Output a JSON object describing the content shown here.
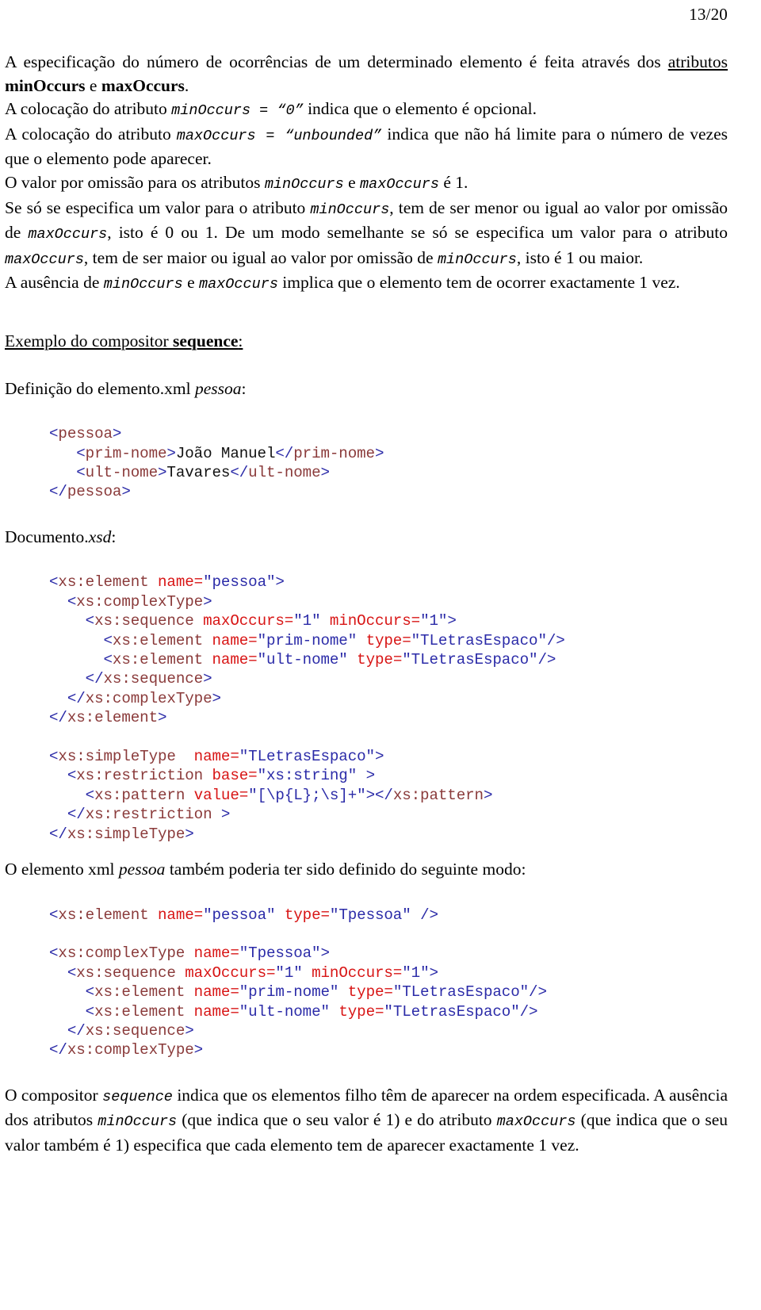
{
  "document": {
    "page_number": "13/20",
    "language": "pt-PT"
  },
  "colors": {
    "bracket": "#2b2ba8",
    "tag_name": "#8a3a3a",
    "attribute_name": "#d81515",
    "attribute_value": "#2b2ba8",
    "text": "#111111"
  },
  "paragraphs": {
    "p1_a": "A especificação do número de ocorrências de um determinado elemento é feita através dos ",
    "p1_underline": "atributos",
    "p1_b": " ",
    "p1_bold1": "minOccurs",
    "p1_c": " e ",
    "p1_bold2": "maxOccurs",
    "p1_d": ".",
    "p2_a": "A colocação do atributo ",
    "p2_code1": "minOccurs = “0”",
    "p2_b": " indica que o elemento é opcional.",
    "p3_a": "A colocação do atributo ",
    "p3_code1": "maxOccurs = “unbounded”",
    "p3_b": " indica que não há limite para o número de vezes que o elemento pode aparecer.",
    "p4_a": "O valor por omissão para os atributos ",
    "p4_code1": "minOccurs",
    "p4_b": " e ",
    "p4_code2": "maxOccurs",
    "p4_c": " é 1.",
    "p5_a": "Se só se especifica um valor para o atributo ",
    "p5_code1": "minOccurs",
    "p5_b": ", tem de ser menor ou igual ao valor por omissão de ",
    "p5_code2": "maxOccurs",
    "p5_c": ", isto é 0 ou 1. De um modo semelhante se só se especifica um valor para o atributo ",
    "p5_code3": "maxOccurs",
    "p5_d": ", tem de ser maior ou igual ao valor por omissão de ",
    "p5_code4": "minOccurs",
    "p5_e": ", isto é 1 ou maior.",
    "p6_a": "A ausência de ",
    "p6_code1": "minOccurs",
    "p6_b": " e ",
    "p6_code2": "maxOccurs",
    "p6_c": " implica que o elemento tem de ocorrer exactamente 1 vez.",
    "heading1_a": "Exemplo do compositor ",
    "heading1_bold": "sequence",
    "heading1_b": ":",
    "caption1_a": "Definição do elemento.xml ",
    "caption1_italic": "pessoa",
    "caption1_b": ":",
    "caption2_a": "Documento.",
    "caption2_italic": "xsd",
    "caption2_b": ":",
    "caption3_a": "O elemento xml ",
    "caption3_italic": "pessoa",
    "caption3_b": " também poderia ter sido definido do seguinte modo:",
    "p7_a": "O compositor ",
    "p7_code1": "sequence",
    "p7_b": " indica que os elementos filho têm de aparecer na ordem especificada. A ausência dos atributos ",
    "p7_code2": "minOccurs",
    "p7_c": " (que indica que o seu valor é 1) e do atributo ",
    "p7_code3": "maxOccurs",
    "p7_d": " (que indica que o seu valor também é 1) especifica que cada elemento tem de aparecer exactamente 1 vez."
  },
  "code_blocks": {
    "xml_pessoa": [
      [
        {
          "t": "br",
          "v": "<"
        },
        {
          "t": "tag",
          "v": "pessoa"
        },
        {
          "t": "br",
          "v": ">"
        }
      ],
      [
        {
          "t": "txt",
          "v": "   "
        },
        {
          "t": "br",
          "v": "<"
        },
        {
          "t": "tag",
          "v": "prim-nome"
        },
        {
          "t": "br",
          "v": ">"
        },
        {
          "t": "txt",
          "v": "João Manuel"
        },
        {
          "t": "br",
          "v": "</"
        },
        {
          "t": "tag",
          "v": "prim-nome"
        },
        {
          "t": "br",
          "v": ">"
        }
      ],
      [
        {
          "t": "txt",
          "v": "   "
        },
        {
          "t": "br",
          "v": "<"
        },
        {
          "t": "tag",
          "v": "ult-nome"
        },
        {
          "t": "br",
          "v": ">"
        },
        {
          "t": "txt",
          "v": "Tavares"
        },
        {
          "t": "br",
          "v": "</"
        },
        {
          "t": "tag",
          "v": "ult-nome"
        },
        {
          "t": "br",
          "v": ">"
        }
      ],
      [
        {
          "t": "br",
          "v": "</"
        },
        {
          "t": "tag",
          "v": "pessoa"
        },
        {
          "t": "br",
          "v": ">"
        }
      ]
    ],
    "xsd_documento": [
      [
        {
          "t": "br",
          "v": "<"
        },
        {
          "t": "tag",
          "v": "xs:element"
        },
        {
          "t": "txt",
          "v": " "
        },
        {
          "t": "attr",
          "v": "name="
        },
        {
          "t": "val",
          "v": "\"pessoa\""
        },
        {
          "t": "br",
          "v": ">"
        }
      ],
      [
        {
          "t": "txt",
          "v": "  "
        },
        {
          "t": "br",
          "v": "<"
        },
        {
          "t": "tag",
          "v": "xs:complexType"
        },
        {
          "t": "br",
          "v": ">"
        }
      ],
      [
        {
          "t": "txt",
          "v": "    "
        },
        {
          "t": "br",
          "v": "<"
        },
        {
          "t": "tag",
          "v": "xs:sequence"
        },
        {
          "t": "txt",
          "v": " "
        },
        {
          "t": "attr",
          "v": "maxOccurs="
        },
        {
          "t": "val",
          "v": "\"1\""
        },
        {
          "t": "txt",
          "v": " "
        },
        {
          "t": "attr",
          "v": "minOccurs="
        },
        {
          "t": "val",
          "v": "\"1\""
        },
        {
          "t": "br",
          "v": ">"
        }
      ],
      [
        {
          "t": "txt",
          "v": "      "
        },
        {
          "t": "br",
          "v": "<"
        },
        {
          "t": "tag",
          "v": "xs:element"
        },
        {
          "t": "txt",
          "v": " "
        },
        {
          "t": "attr",
          "v": "name="
        },
        {
          "t": "val",
          "v": "\"prim-nome\""
        },
        {
          "t": "txt",
          "v": " "
        },
        {
          "t": "attr",
          "v": "type="
        },
        {
          "t": "val",
          "v": "\"TLetrasEspaco\""
        },
        {
          "t": "br",
          "v": "/>"
        }
      ],
      [
        {
          "t": "txt",
          "v": "      "
        },
        {
          "t": "br",
          "v": "<"
        },
        {
          "t": "tag",
          "v": "xs:element"
        },
        {
          "t": "txt",
          "v": " "
        },
        {
          "t": "attr",
          "v": "name="
        },
        {
          "t": "val",
          "v": "\"ult-nome\""
        },
        {
          "t": "txt",
          "v": " "
        },
        {
          "t": "attr",
          "v": "type="
        },
        {
          "t": "val",
          "v": "\"TLetrasEspaco\""
        },
        {
          "t": "br",
          "v": "/>"
        }
      ],
      [
        {
          "t": "txt",
          "v": "    "
        },
        {
          "t": "br",
          "v": "</"
        },
        {
          "t": "tag",
          "v": "xs:sequence"
        },
        {
          "t": "br",
          "v": ">"
        }
      ],
      [
        {
          "t": "txt",
          "v": "  "
        },
        {
          "t": "br",
          "v": "</"
        },
        {
          "t": "tag",
          "v": "xs:complexType"
        },
        {
          "t": "br",
          "v": ">"
        }
      ],
      [
        {
          "t": "br",
          "v": "</"
        },
        {
          "t": "tag",
          "v": "xs:element"
        },
        {
          "t": "br",
          "v": ">"
        }
      ],
      [
        {
          "t": "txt",
          "v": ""
        }
      ],
      [
        {
          "t": "br",
          "v": "<"
        },
        {
          "t": "tag",
          "v": "xs:simpleType"
        },
        {
          "t": "txt",
          "v": "  "
        },
        {
          "t": "attr",
          "v": "name="
        },
        {
          "t": "val",
          "v": "\"TLetrasEspaco\""
        },
        {
          "t": "br",
          "v": ">"
        }
      ],
      [
        {
          "t": "txt",
          "v": "  "
        },
        {
          "t": "br",
          "v": "<"
        },
        {
          "t": "tag",
          "v": "xs:restriction"
        },
        {
          "t": "txt",
          "v": " "
        },
        {
          "t": "attr",
          "v": "base="
        },
        {
          "t": "val",
          "v": "\"xs:string\""
        },
        {
          "t": "txt",
          "v": " "
        },
        {
          "t": "br",
          "v": ">"
        }
      ],
      [
        {
          "t": "txt",
          "v": "    "
        },
        {
          "t": "br",
          "v": "<"
        },
        {
          "t": "tag",
          "v": "xs:pattern"
        },
        {
          "t": "txt",
          "v": " "
        },
        {
          "t": "attr",
          "v": "value="
        },
        {
          "t": "val",
          "v": "\"[\\p{L};\\s]+\""
        },
        {
          "t": "br",
          "v": "></"
        },
        {
          "t": "tag",
          "v": "xs:pattern"
        },
        {
          "t": "br",
          "v": ">"
        }
      ],
      [
        {
          "t": "txt",
          "v": "  "
        },
        {
          "t": "br",
          "v": "</"
        },
        {
          "t": "tag",
          "v": "xs:restriction"
        },
        {
          "t": "txt",
          "v": " "
        },
        {
          "t": "br",
          "v": ">"
        }
      ],
      [
        {
          "t": "br",
          "v": "</"
        },
        {
          "t": "tag",
          "v": "xs:simpleType"
        },
        {
          "t": "br",
          "v": ">"
        }
      ]
    ],
    "xsd_tpessoa": [
      [
        {
          "t": "br",
          "v": "<"
        },
        {
          "t": "tag",
          "v": "xs:element"
        },
        {
          "t": "txt",
          "v": " "
        },
        {
          "t": "attr",
          "v": "name="
        },
        {
          "t": "val",
          "v": "\"pessoa\""
        },
        {
          "t": "txt",
          "v": " "
        },
        {
          "t": "attr",
          "v": "type="
        },
        {
          "t": "val",
          "v": "\"Tpessoa\""
        },
        {
          "t": "txt",
          "v": " "
        },
        {
          "t": "br",
          "v": "/>"
        }
      ],
      [
        {
          "t": "txt",
          "v": ""
        }
      ],
      [
        {
          "t": "br",
          "v": "<"
        },
        {
          "t": "tag",
          "v": "xs:complexType"
        },
        {
          "t": "txt",
          "v": " "
        },
        {
          "t": "attr",
          "v": "name="
        },
        {
          "t": "val",
          "v": "\"Tpessoa\""
        },
        {
          "t": "br",
          "v": ">"
        }
      ],
      [
        {
          "t": "txt",
          "v": "  "
        },
        {
          "t": "br",
          "v": "<"
        },
        {
          "t": "tag",
          "v": "xs:sequence"
        },
        {
          "t": "txt",
          "v": " "
        },
        {
          "t": "attr",
          "v": "maxOccurs="
        },
        {
          "t": "val",
          "v": "\"1\""
        },
        {
          "t": "txt",
          "v": " "
        },
        {
          "t": "attr",
          "v": "minOccurs="
        },
        {
          "t": "val",
          "v": "\"1\""
        },
        {
          "t": "br",
          "v": ">"
        }
      ],
      [
        {
          "t": "txt",
          "v": "    "
        },
        {
          "t": "br",
          "v": "<"
        },
        {
          "t": "tag",
          "v": "xs:element"
        },
        {
          "t": "txt",
          "v": " "
        },
        {
          "t": "attr",
          "v": "name="
        },
        {
          "t": "val",
          "v": "\"prim-nome\""
        },
        {
          "t": "txt",
          "v": " "
        },
        {
          "t": "attr",
          "v": "type="
        },
        {
          "t": "val",
          "v": "\"TLetrasEspaco\""
        },
        {
          "t": "br",
          "v": "/>"
        }
      ],
      [
        {
          "t": "txt",
          "v": "    "
        },
        {
          "t": "br",
          "v": "<"
        },
        {
          "t": "tag",
          "v": "xs:element"
        },
        {
          "t": "txt",
          "v": " "
        },
        {
          "t": "attr",
          "v": "name="
        },
        {
          "t": "val",
          "v": "\"ult-nome\""
        },
        {
          "t": "txt",
          "v": " "
        },
        {
          "t": "attr",
          "v": "type="
        },
        {
          "t": "val",
          "v": "\"TLetrasEspaco\""
        },
        {
          "t": "br",
          "v": "/>"
        }
      ],
      [
        {
          "t": "txt",
          "v": "  "
        },
        {
          "t": "br",
          "v": "</"
        },
        {
          "t": "tag",
          "v": "xs:sequence"
        },
        {
          "t": "br",
          "v": ">"
        }
      ],
      [
        {
          "t": "br",
          "v": "</"
        },
        {
          "t": "tag",
          "v": "xs:complexType"
        },
        {
          "t": "br",
          "v": ">"
        }
      ]
    ]
  }
}
